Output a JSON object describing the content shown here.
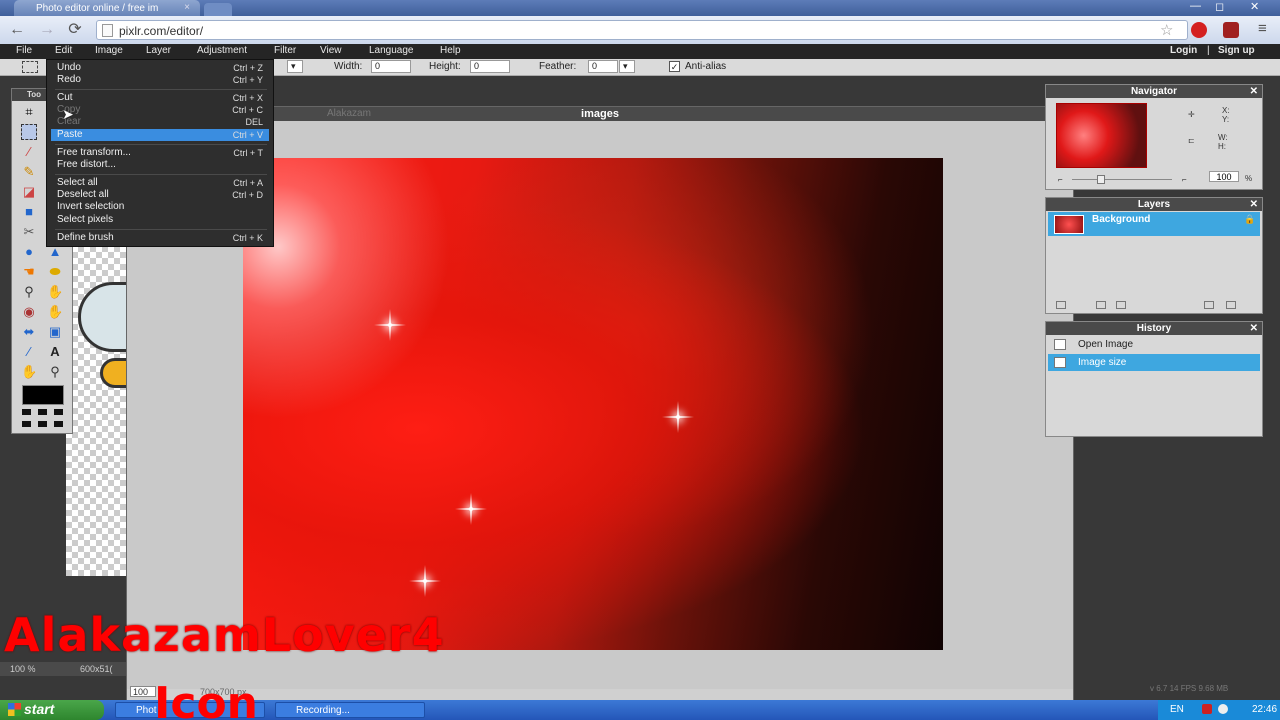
{
  "browser": {
    "tab_title": "Photo editor online / free im",
    "tab_close": "×",
    "url": "pixlr.com/editor/",
    "back": "←",
    "forward": "→",
    "reload": "⟳",
    "minimize": "—",
    "maximize": "◻",
    "close": "✕"
  },
  "menubar": {
    "items": [
      "File",
      "Edit",
      "Image",
      "Layer",
      "Adjustment",
      "Filter",
      "View",
      "Language",
      "Help"
    ],
    "login": "Login",
    "separator": "|",
    "signup": "Sign up"
  },
  "options": {
    "width_label": "Width:",
    "width_value": "0",
    "height_label": "Height:",
    "height_value": "0",
    "feather_label": "Feather:",
    "feather_value": "0",
    "antialias_label": "Anti-alias",
    "antialias_checked": true
  },
  "toolbox": {
    "title": "Too"
  },
  "edit_menu": {
    "items": [
      {
        "label": "Undo",
        "shortcut": "Ctrl + Z"
      },
      {
        "label": "Redo",
        "shortcut": "Ctrl + Y"
      },
      {
        "label": "Cut",
        "shortcut": "Ctrl + X"
      },
      {
        "label": "Copy",
        "shortcut": "Ctrl + C"
      },
      {
        "label": "Clear",
        "shortcut": "DEL"
      },
      {
        "label": "Paste",
        "shortcut": "Ctrl + V"
      },
      {
        "label": "Free transform...",
        "shortcut": "Ctrl + T"
      },
      {
        "label": "Free distort...",
        "shortcut": ""
      },
      {
        "label": "Select all",
        "shortcut": "Ctrl + A"
      },
      {
        "label": "Deselect all",
        "shortcut": "Ctrl + D"
      },
      {
        "label": "Invert selection",
        "shortcut": ""
      },
      {
        "label": "Select pixels",
        "shortcut": ""
      },
      {
        "label": "Define brush",
        "shortcut": "Ctrl + K"
      }
    ],
    "highlighted": "Paste"
  },
  "document": {
    "title": "images",
    "ghost_title": "Alakazam",
    "zoom": "100",
    "size": "700x700 px"
  },
  "bg_document": {
    "zoom": "100 %",
    "size": "600x51("
  },
  "navigator": {
    "title": "Navigator",
    "x_label": "X:",
    "y_label": "Y:",
    "w_label": "W:",
    "h_label": "H:",
    "zoom_value": "100",
    "zoom_unit": "%"
  },
  "layers": {
    "title": "Layers",
    "items": [
      {
        "name": "Background",
        "selected": true
      }
    ]
  },
  "history": {
    "title": "History",
    "items": [
      {
        "name": "Open Image",
        "selected": false
      },
      {
        "name": "Image size",
        "selected": true
      }
    ]
  },
  "status": {
    "fps": "v 6.7    14 FPS 9.68 MB"
  },
  "watermark": {
    "line1": "AlakazamLover4",
    "line2": "Icon"
  },
  "taskbar": {
    "start": "start",
    "buttons": [
      "Phot",
      "Recording..."
    ],
    "lang": "EN",
    "time": "22:46"
  },
  "colors": {
    "accent": "#3ea7e0",
    "menu_bg": "#2e2e2e",
    "watermark": "#ff0000"
  }
}
